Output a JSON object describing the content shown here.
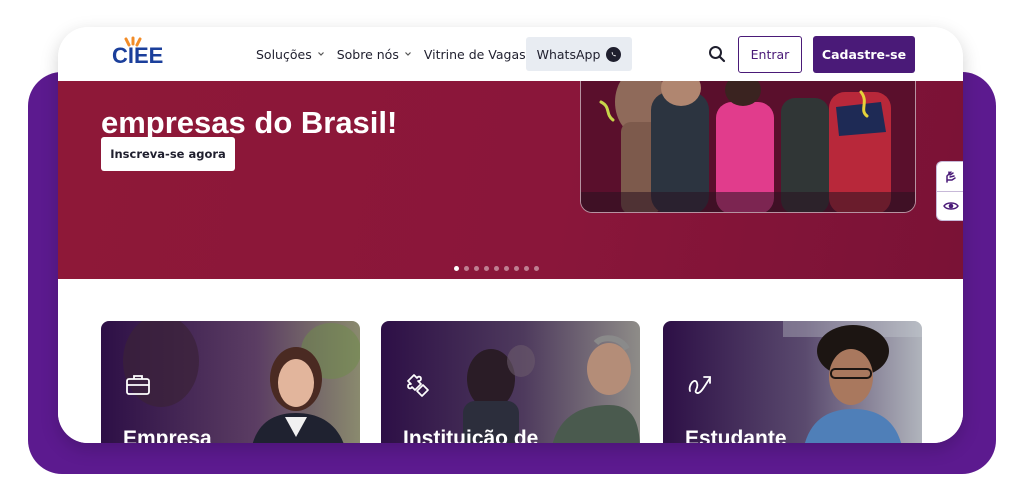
{
  "brand": {
    "logo_text": "CIEE"
  },
  "nav": {
    "items": [
      {
        "label": "Soluções",
        "has_dropdown": true
      },
      {
        "label": "Sobre nós",
        "has_dropdown": true
      },
      {
        "label": "Vitrine de Vagas",
        "has_dropdown": false
      }
    ],
    "whatsapp_label": "WhatsApp",
    "login_label": "Entrar",
    "signup_label": "Cadastre-se"
  },
  "hero": {
    "headline_partial": "empresas do Brasil!",
    "cta_label": "Inscreva-se agora",
    "carousel": {
      "slides": 9,
      "active_index": 0
    }
  },
  "cards": [
    {
      "title": "Empresa",
      "icon": "briefcase-icon"
    },
    {
      "title": "Instituição de",
      "icon": "puzzle-icon"
    },
    {
      "title": "Estudante",
      "icon": "arrow-path-icon"
    }
  ],
  "accessibility": {
    "icons": [
      "sign-language-icon",
      "eye-icon"
    ]
  },
  "colors": {
    "brand_purple": "#4a1a78",
    "frame_purple": "#5c1a8f",
    "hero_crimson": "#8e1838",
    "logo_blue": "#1b3f9b",
    "logo_accent": "#f28c28"
  }
}
